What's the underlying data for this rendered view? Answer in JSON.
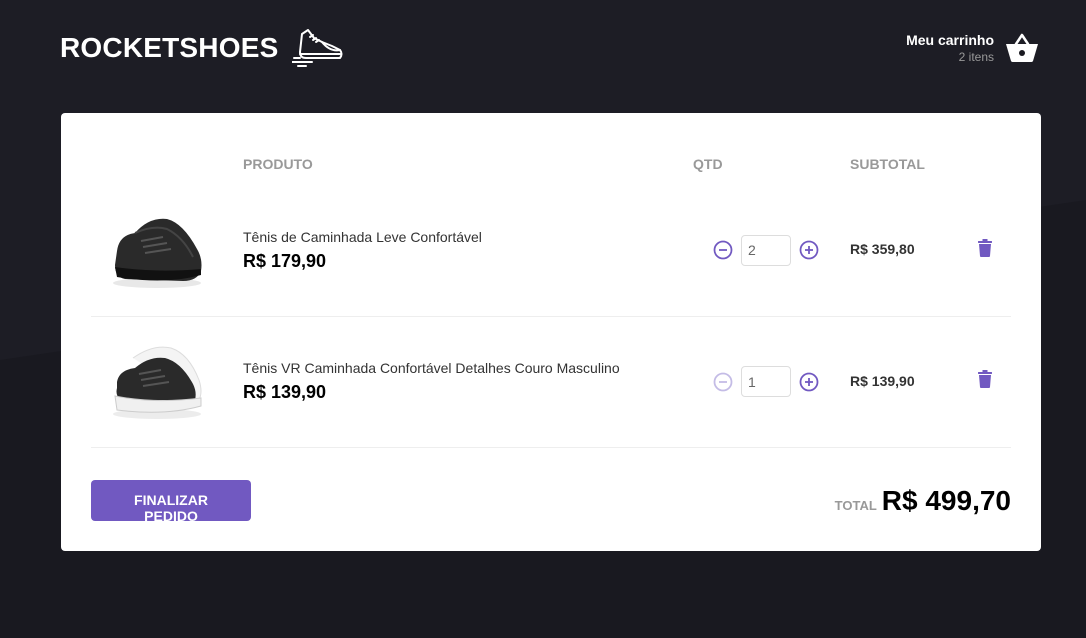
{
  "header": {
    "logo_text": "ROCKETSHOES",
    "cart_title": "Meu carrinho",
    "cart_count": "2 itens"
  },
  "table": {
    "columns": [
      "",
      "PRODUTO",
      "QTD",
      "SUBTOTAL",
      ""
    ],
    "items": [
      {
        "name": "Tênis de Caminhada Leve Confortável",
        "price": "R$ 179,90",
        "quantity": "2",
        "subtotal": "R$ 359,80",
        "shoe_color": "black"
      },
      {
        "name": "Tênis VR Caminhada Confortável Detalhes Couro Masculino",
        "price": "R$ 139,90",
        "quantity": "1",
        "subtotal": "R$ 139,90",
        "shoe_color": "black-white"
      }
    ]
  },
  "footer": {
    "finish_label": "Finalizar pedido",
    "total_label": "TOTAL",
    "total_value": "R$ 499,70"
  },
  "colors": {
    "accent": "#7159c1",
    "background": "#191920",
    "disabled": "#c4bce6"
  }
}
